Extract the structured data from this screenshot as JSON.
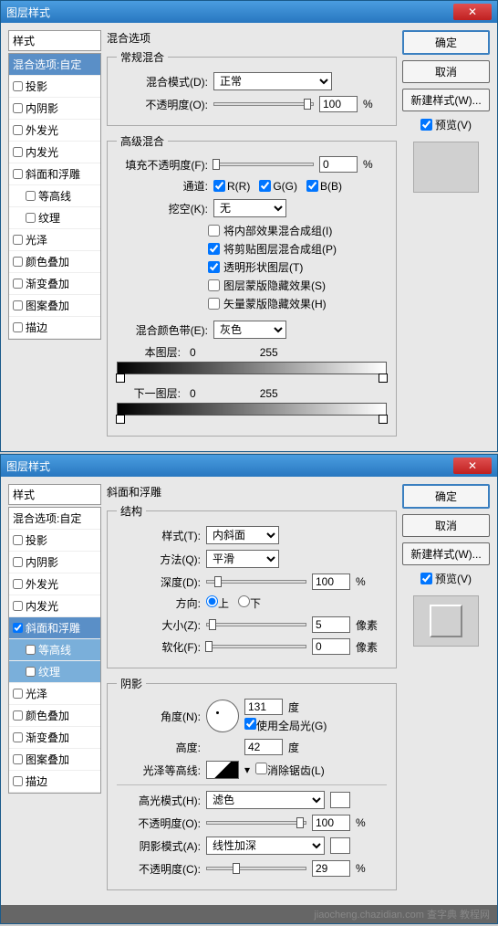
{
  "dialog1": {
    "title": "图层样式",
    "sidebar_title": "样式",
    "styles": [
      "混合选项:自定",
      "投影",
      "内阴影",
      "外发光",
      "内发光",
      "斜面和浮雕",
      "等高线",
      "纹理",
      "光泽",
      "颜色叠加",
      "渐变叠加",
      "图案叠加",
      "描边"
    ],
    "section": "混合选项",
    "normal": {
      "legend": "常规混合",
      "mode_label": "混合模式(D):",
      "mode_value": "正常",
      "opacity_label": "不透明度(O):",
      "opacity_value": "100",
      "pct": "%"
    },
    "advanced": {
      "legend": "高级混合",
      "fill_label": "填充不透明度(F):",
      "fill_value": "0",
      "pct": "%",
      "channel_label": "通道:",
      "r": "R(R)",
      "g": "G(G)",
      "b": "B(B)",
      "knockout_label": "挖空(K):",
      "knockout_value": "无",
      "c1": "将内部效果混合成组(I)",
      "c2": "将剪贴图层混合成组(P)",
      "c3": "透明形状图层(T)",
      "c4": "图层蒙版隐藏效果(S)",
      "c5": "矢量蒙版隐藏效果(H)"
    },
    "blendif": {
      "label": "混合颜色带(E):",
      "value": "灰色",
      "this_layer": "本图层:",
      "v0": "0",
      "v255": "255",
      "under_layer": "下一图层:"
    },
    "buttons": {
      "ok": "确定",
      "cancel": "取消",
      "new_style": "新建样式(W)...",
      "preview": "预览(V)"
    }
  },
  "dialog2": {
    "title": "图层样式",
    "sidebar_title": "样式",
    "styles": [
      "混合选项:自定",
      "投影",
      "内阴影",
      "外发光",
      "内发光",
      "斜面和浮雕",
      "等高线",
      "纹理",
      "光泽",
      "颜色叠加",
      "渐变叠加",
      "图案叠加",
      "描边"
    ],
    "section": "斜面和浮雕",
    "struct": {
      "legend": "结构",
      "style_label": "样式(T):",
      "style_value": "内斜面",
      "tech_label": "方法(Q):",
      "tech_value": "平滑",
      "depth_label": "深度(D):",
      "depth_value": "100",
      "pct": "%",
      "dir_label": "方向:",
      "dir_up": "上",
      "dir_down": "下",
      "size_label": "大小(Z):",
      "size_value": "5",
      "px": "像素",
      "soften_label": "软化(F):",
      "soften_value": "0"
    },
    "shading": {
      "legend": "阴影",
      "angle_label": "角度(N):",
      "angle_value": "131",
      "deg": "度",
      "global": "使用全局光(G)",
      "alt_label": "高度:",
      "alt_value": "42",
      "gloss_label": "光泽等高线:",
      "anti": "消除锯齿(L)",
      "hl_mode_label": "高光模式(H):",
      "hl_mode_value": "滤色",
      "hl_op_label": "不透明度(O):",
      "hl_op_value": "100",
      "sh_mode_label": "阴影模式(A):",
      "sh_mode_value": "线性加深",
      "sh_op_label": "不透明度(C):",
      "sh_op_value": "29",
      "pct": "%"
    },
    "buttons": {
      "ok": "确定",
      "cancel": "取消",
      "new_style": "新建样式(W)...",
      "preview": "预览(V)"
    }
  },
  "watermark": "jiaocheng.chazidian.com 查字典 教程网"
}
